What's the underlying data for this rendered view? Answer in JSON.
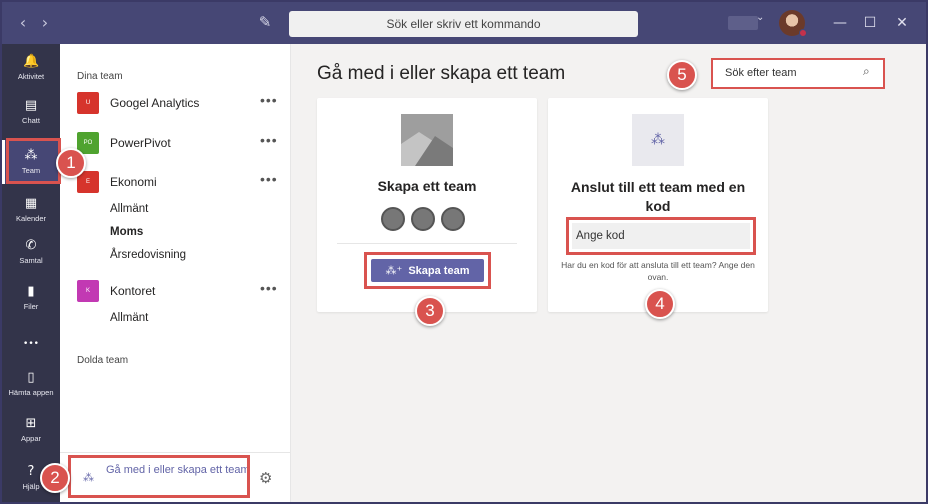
{
  "titlebar": {
    "back_glyph": "‹",
    "forward_glyph": "›",
    "compose_icon": "compose-icon",
    "search_placeholder": "Sök eller skriv ett kommando",
    "minimize": "—",
    "maximize": "☐",
    "close": "✕"
  },
  "rail": {
    "items": [
      {
        "label": "Aktivitet",
        "icon": "bell-icon",
        "glyph": "🔔"
      },
      {
        "label": "Chatt",
        "icon": "chat-icon",
        "glyph": "▤"
      },
      {
        "label": "Team",
        "icon": "teams-icon",
        "glyph": "⁂"
      },
      {
        "label": "Kalender",
        "icon": "calendar-icon",
        "glyph": "▦"
      },
      {
        "label": "Samtal",
        "icon": "phone-icon",
        "glyph": "✆"
      },
      {
        "label": "Filer",
        "icon": "files-icon",
        "glyph": "▮"
      },
      {
        "label": "",
        "icon": "more-icon",
        "glyph": "•••"
      },
      {
        "label": "Hämta appen",
        "icon": "mobile-icon",
        "glyph": "▯"
      },
      {
        "label": "Appar",
        "icon": "apps-icon",
        "glyph": "⊞"
      },
      {
        "label": "Hjälp",
        "icon": "help-icon",
        "glyph": "?"
      }
    ]
  },
  "teams_panel": {
    "your_teams_label": "Dina team",
    "teams": [
      {
        "name": "Googel Analytics",
        "initials": "U",
        "color": "#d6342c",
        "channels": []
      },
      {
        "name": "PowerPivot",
        "initials": "PO",
        "color": "#4fa32f",
        "channels": []
      },
      {
        "name": "Ekonomi",
        "initials": "E",
        "color": "#d6342c",
        "channels": [
          {
            "name": "Allmänt",
            "bold": false
          },
          {
            "name": "Moms",
            "bold": true
          },
          {
            "name": "Årsredovisning",
            "bold": false
          }
        ]
      },
      {
        "name": "Kontoret",
        "initials": "K",
        "color": "#c239b3",
        "channels": [
          {
            "name": "Allmänt",
            "bold": false
          }
        ]
      }
    ],
    "more_glyph": "•••",
    "hidden_teams_label": "Dolda team",
    "join_create_label": "Gå med i eller skapa ett team",
    "settings_icon": "gear-icon"
  },
  "main": {
    "title": "Gå med i eller skapa ett team",
    "team_search_placeholder": "Sök efter team",
    "create_card": {
      "title": "Skapa ett team",
      "button_label": "Skapa team"
    },
    "join_card": {
      "title": "Anslut till ett team med en kod",
      "code_placeholder": "Ange kod",
      "help_text": "Har du en kod för att ansluta till ett team? Ange den ovan."
    }
  },
  "annotations": {
    "markers": [
      "1",
      "2",
      "3",
      "4",
      "5"
    ],
    "color": "#d9534f"
  },
  "colors": {
    "titlebar": "#464775",
    "rail": "#33344a",
    "accent": "#6264a7",
    "main_bg": "#f3f2f1"
  }
}
